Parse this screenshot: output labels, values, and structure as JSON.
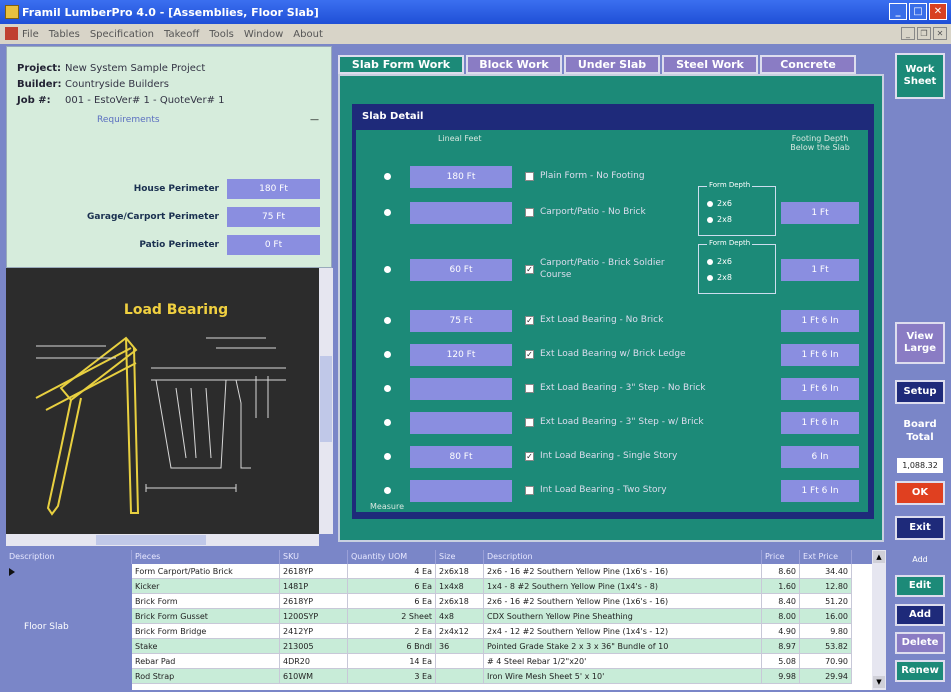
{
  "window": {
    "title": "Framil LumberPro 4.0 - [Assemblies, Floor Slab]",
    "menu": [
      "File",
      "Tables",
      "Specification",
      "Takeoff",
      "Tools",
      "Window",
      "About"
    ]
  },
  "project": {
    "project_label": "Project:",
    "project_value": "New System Sample Project",
    "builder_label": "Builder:",
    "builder_value": "Countryside Builders",
    "job_label": "Job #:",
    "job_value": "001 - EstoVer# 1 - QuoteVer# 1",
    "requirements": "Requirements",
    "dash": "—"
  },
  "perimeters": [
    {
      "label": "House Perimeter",
      "value": "180 Ft"
    },
    {
      "label": "Garage/Carport Perimeter",
      "value": "75 Ft"
    },
    {
      "label": "Patio Perimeter",
      "value": "0 Ft"
    }
  ],
  "drawing": {
    "title": "Load Bearing"
  },
  "tabs": [
    {
      "label": "Slab Form Work",
      "active": true
    },
    {
      "label": "Block Work",
      "active": false
    },
    {
      "label": "Under Slab",
      "active": false
    },
    {
      "label": "Steel Work",
      "active": false
    },
    {
      "label": "Concrete",
      "active": false
    }
  ],
  "slab_detail": {
    "header": "Slab Detail",
    "col_linear": "Lineal Feet",
    "col_depth": "Footing Depth Below the Slab",
    "measure_label": "Measure",
    "footing_group_1": {
      "title": "Form Depth",
      "opt1": "2x6",
      "opt2": "2x8"
    },
    "footing_group_2": {
      "title": "Form Depth",
      "opt1": "2x6",
      "opt2": "2x8"
    },
    "rows": [
      {
        "lf": "180 Ft",
        "checked": false,
        "label": "Plain Form - No Footing",
        "depth": ""
      },
      {
        "lf": "",
        "checked": false,
        "label": "Carport/Patio - No Brick",
        "depth": "1 Ft"
      },
      {
        "lf": "60 Ft",
        "checked": true,
        "label": "Carport/Patio - Brick Soldier Course",
        "depth": "1 Ft"
      },
      {
        "lf": "75 Ft",
        "checked": true,
        "label": "Ext Load Bearing - No Brick",
        "depth": "1 Ft 6 In"
      },
      {
        "lf": "120 Ft",
        "checked": true,
        "label": "Ext Load Bearing w/ Brick Ledge",
        "depth": "1 Ft 6 In"
      },
      {
        "lf": "",
        "checked": false,
        "label": "Ext Load Bearing - 3\" Step - No Brick",
        "depth": "1 Ft 6 In"
      },
      {
        "lf": "",
        "checked": false,
        "label": "Ext Load Bearing - 3\" Step - w/ Brick",
        "depth": "1 Ft 6 In"
      },
      {
        "lf": "80 Ft",
        "checked": true,
        "label": "Int Load Bearing - Single Story",
        "depth": "6 In"
      },
      {
        "lf": "",
        "checked": false,
        "label": "Int Load Bearing - Two Story",
        "depth": "1 Ft 6 In"
      }
    ]
  },
  "right_buttons": {
    "work_sheet": "Work Sheet",
    "view_large": "View Large",
    "setup": "Setup",
    "board_total_label": "Board Total",
    "board_total_value": "1,088.32",
    "ok": "OK",
    "exit": "Exit",
    "add_label": "Add",
    "edit": "Edit",
    "add": "Add",
    "delete": "Delete",
    "renew": "Renew"
  },
  "grid": {
    "columns": [
      "Description",
      "Pieces",
      "SKU",
      "Quantity UOM",
      "Size",
      "Description",
      "Price",
      "Ext Price"
    ],
    "section": "Floor Slab",
    "rows": [
      [
        "Form Carport/Patio Brick",
        "2618YP",
        "4 Ea",
        "2x6x18",
        "2x6 - 16 #2 Southern Yellow Pine (1x6's - 16)",
        "8.60",
        "34.40"
      ],
      [
        "Kicker",
        "1481P",
        "6 Ea",
        "1x4x8",
        "1x4 - 8 #2 Southern Yellow Pine (1x4's - 8)",
        "1.60",
        "12.80"
      ],
      [
        "Brick Form",
        "2618YP",
        "6 Ea",
        "2x6x18",
        "2x6 - 16 #2 Southern Yellow Pine (1x6's - 16)",
        "8.40",
        "51.20"
      ],
      [
        "Brick Form Gusset",
        "1200SYP",
        "2 Sheet",
        "4x8",
        "CDX Southern Yellow Pine Sheathing",
        "8.00",
        "16.00"
      ],
      [
        "Brick Form Bridge",
        "2412YP",
        "2 Ea",
        "2x4x12",
        "2x4 - 12 #2 Southern Yellow Pine (1x4's - 12)",
        "4.90",
        "9.80"
      ],
      [
        "Stake",
        "213005",
        "6 Bndl",
        "36",
        "Pointed Grade Stake 2 x 3 x 36\" Bundle of 10",
        "8.97",
        "53.82"
      ],
      [
        "Rebar Pad",
        "4DR20",
        "14 Ea",
        "",
        "# 4 Steel Rebar 1/2\"x20'",
        "5.08",
        "70.90"
      ],
      [
        "Rod Strap",
        "610WM",
        "3 Ea",
        "",
        "Iron Wire Mesh Sheet 5' x 10'",
        "9.98",
        "29.94"
      ]
    ]
  }
}
